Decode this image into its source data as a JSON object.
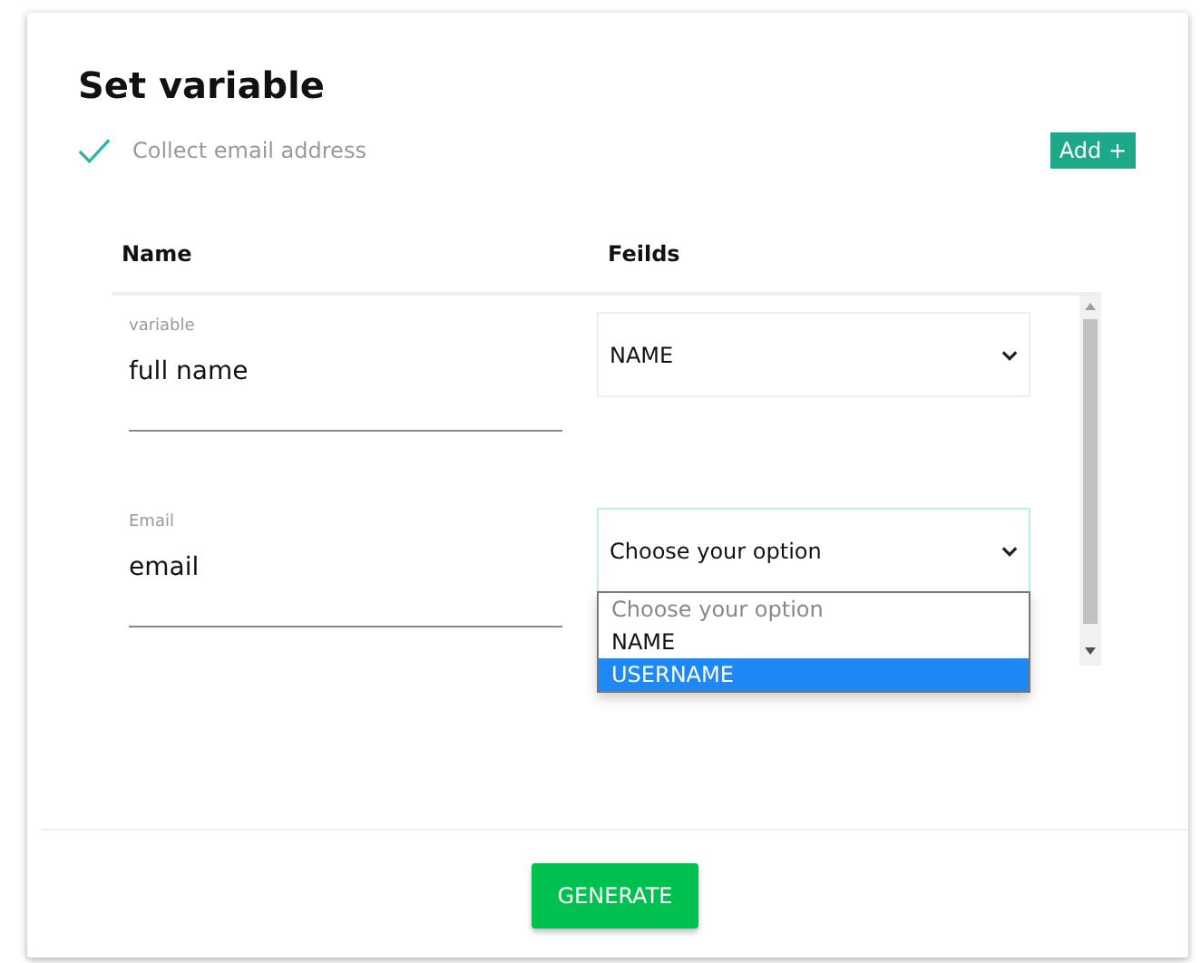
{
  "title": "Set variable",
  "collect": {
    "checked": true,
    "label": "Collect email address"
  },
  "add_button": "Add +",
  "table": {
    "columns": [
      "Name",
      "Feilds"
    ],
    "rows": [
      {
        "label": "variable",
        "value": "full name",
        "select": "NAME",
        "focused": false
      },
      {
        "label": "Email",
        "value": "email",
        "select": "Choose your option",
        "focused": true,
        "dropdown": [
          {
            "label": "Choose your option",
            "selected": false,
            "placeholder": true
          },
          {
            "label": "NAME",
            "selected": false,
            "placeholder": false
          },
          {
            "label": "USERNAME",
            "selected": true,
            "placeholder": false
          }
        ]
      }
    ]
  },
  "generate_button": "GENERATE"
}
